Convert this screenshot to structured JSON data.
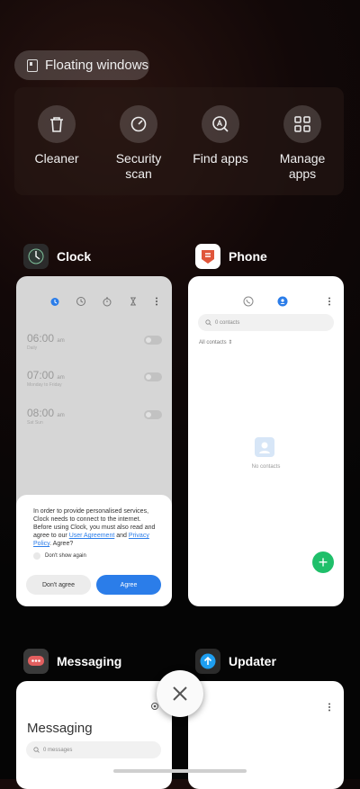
{
  "floating": {
    "label": "Floating windows"
  },
  "tools": [
    {
      "line1": "Cleaner",
      "line2": "",
      "icon": "trash-icon"
    },
    {
      "line1": "Security",
      "line2": "scan",
      "icon": "security-icon"
    },
    {
      "line1": "Find apps",
      "line2": "",
      "icon": "find-apps-icon"
    },
    {
      "line1": "Manage",
      "line2": "apps",
      "icon": "grid-icon"
    }
  ],
  "apps": {
    "clock": {
      "name": "Clock",
      "alarms": [
        {
          "time": "06:00",
          "ampm": "am",
          "sub": "Daily"
        },
        {
          "time": "07:00",
          "ampm": "am",
          "sub": "Monday to Friday"
        },
        {
          "time": "08:00",
          "ampm": "am",
          "sub": "Sat Sun"
        }
      ],
      "dialog": {
        "text_start": "In order to provide personalised services, Clock needs to connect to the internet. Before using Clock, you must also read and agree to our ",
        "link1": "User Agreement",
        "and": " and ",
        "link2": "Privacy Policy",
        "text_end": ". Agree?",
        "checkbox": "Don't show again",
        "disagree": "Don't agree",
        "agree": "Agree"
      }
    },
    "phone": {
      "name": "Phone",
      "search_placeholder": "0 contacts",
      "filter": "All contacts",
      "empty": "No contacts"
    },
    "messaging": {
      "name": "Messaging",
      "title": "Messaging",
      "search_placeholder": "0 messages"
    },
    "updater": {
      "name": "Updater"
    }
  },
  "colors": {
    "accent": "#2b7de9",
    "fab": "#1fbf6a"
  }
}
